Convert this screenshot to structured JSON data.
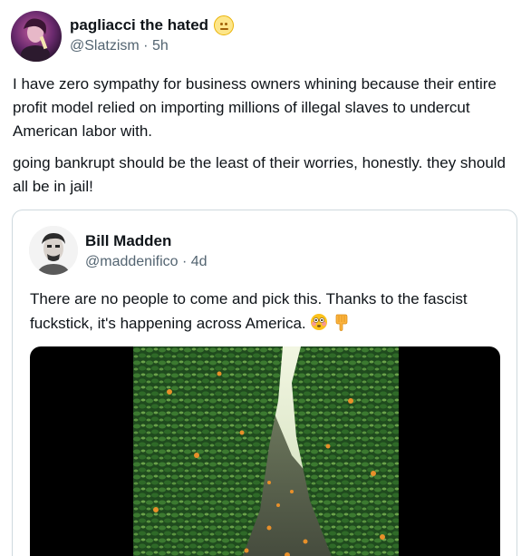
{
  "post": {
    "display_name": "pagliacci the hated",
    "name_emoji": "neutral-face-emoji",
    "handle": "@Slatzism",
    "separator": "·",
    "time": "5h",
    "paragraph_1": "I have zero sympathy for business owners whining because their entire profit model relied on importing millions of illegal slaves to undercut American labor with.",
    "paragraph_2": "going bankrupt should be the least of their worries, honestly. they should all be in jail!"
  },
  "quote": {
    "display_name": "Bill Madden",
    "handle": "@maddenifico",
    "separator": "·",
    "time": "4d",
    "text": "There are no people to come and pick this. Thanks to the fascist fuckstick, it's happening across America.",
    "emojis": [
      "flushed-face-emoji",
      "pointing-down-emoji"
    ],
    "media": "video-thumbnail"
  },
  "colors": {
    "text_primary": "#0f1419",
    "text_secondary": "#536471",
    "card_border": "#cfd9de"
  }
}
